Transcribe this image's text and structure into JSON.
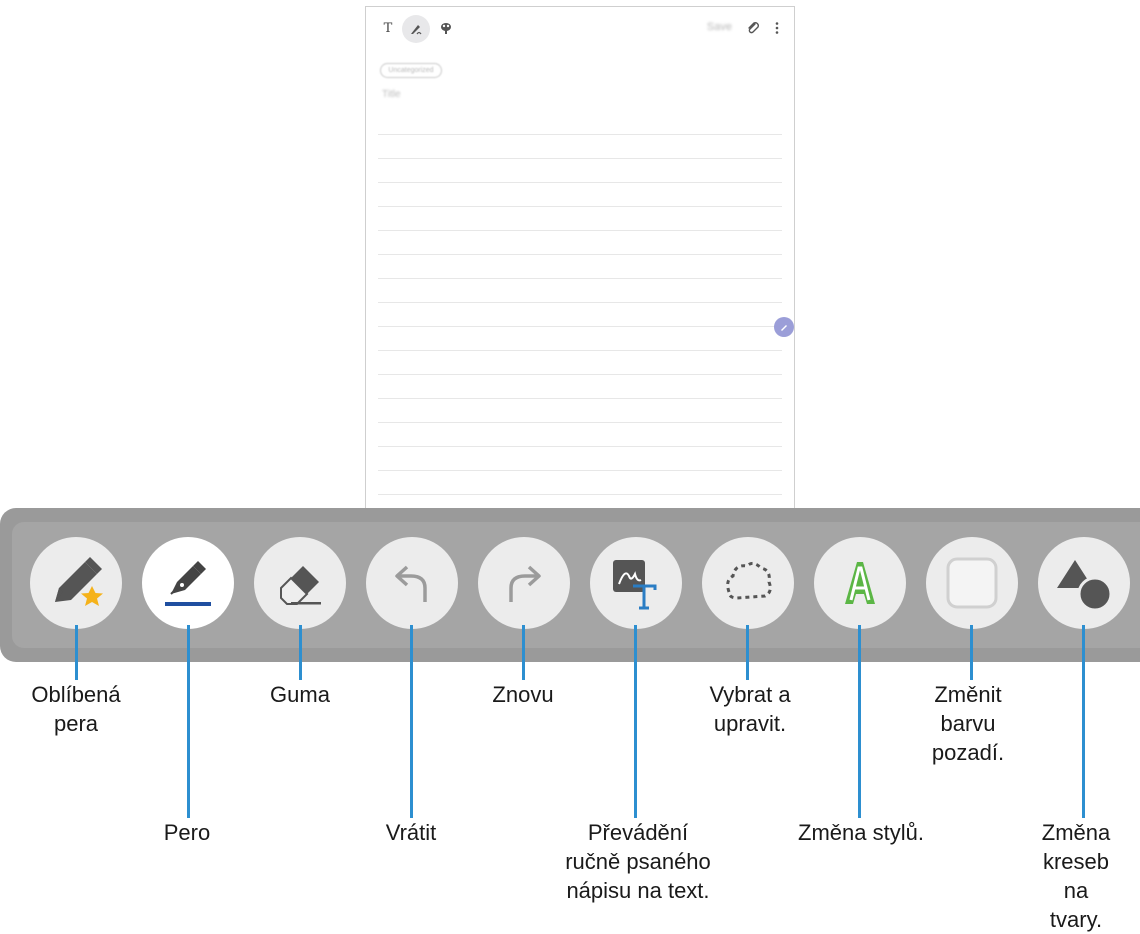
{
  "phone": {
    "save_label": "Save",
    "chip_label": "Uncategorized",
    "title_placeholder": "Title"
  },
  "toolbar": {
    "tools": [
      {
        "name": "favorite-pens",
        "icon": "pen-star-icon",
        "label": "Oblíbená\npera"
      },
      {
        "name": "pen",
        "icon": "fountain-pen-icon",
        "label": "Pero"
      },
      {
        "name": "eraser",
        "icon": "eraser-icon",
        "label": "Guma"
      },
      {
        "name": "undo",
        "icon": "undo-arrow-icon",
        "label": "Vrátit"
      },
      {
        "name": "redo",
        "icon": "redo-arrow-icon",
        "label": "Znovu"
      },
      {
        "name": "handwriting-to-text",
        "icon": "handwriting-to-text-icon",
        "label": "Převádění\nručně psaného\nnápisu na text."
      },
      {
        "name": "select-edit",
        "icon": "lasso-icon",
        "label": "Vybrat a\nupravit."
      },
      {
        "name": "change-style",
        "icon": "outlined-letter-a-icon",
        "label": "Změna stylů."
      },
      {
        "name": "background-color",
        "icon": "square-icon",
        "label": "Změnit\nbarvu\npozadí."
      },
      {
        "name": "shapes",
        "icon": "shapes-icon",
        "label": "Změna\nkreseb na\ntvary."
      }
    ]
  },
  "colors": {
    "leader_line": "#2d8fd0",
    "pen_underline": "#1f4fa0",
    "star": "#f5b21a",
    "style_a": "#5bb645",
    "text_t": "#2a7dc4"
  }
}
